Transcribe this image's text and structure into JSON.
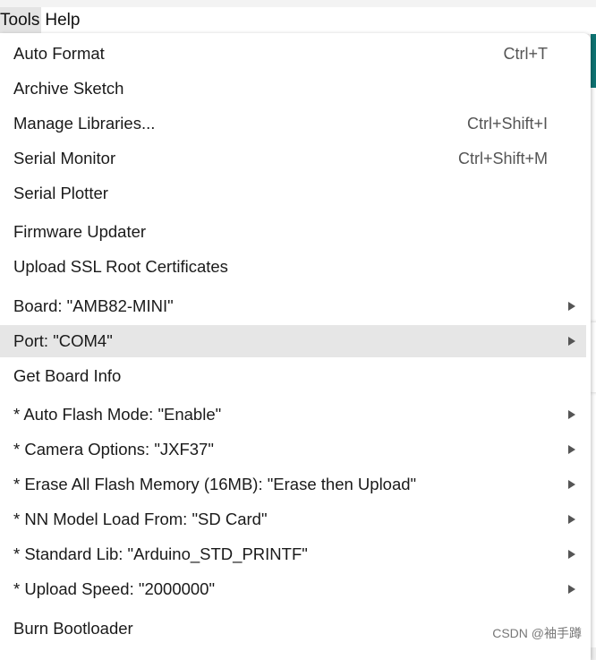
{
  "menubar": {
    "items": [
      {
        "label": "Tools",
        "active": true
      },
      {
        "label": "Help",
        "active": false
      }
    ]
  },
  "menu": {
    "items": [
      {
        "label": "Auto Format",
        "shortcut": "Ctrl+T"
      },
      {
        "label": "Archive Sketch"
      },
      {
        "label": "Manage Libraries...",
        "shortcut": "Ctrl+Shift+I"
      },
      {
        "label": "Serial Monitor",
        "shortcut": "Ctrl+Shift+M"
      },
      {
        "label": "Serial Plotter"
      },
      {
        "label": "Firmware Updater"
      },
      {
        "label": "Upload SSL Root Certificates"
      },
      {
        "label": "Board: \"AMB82-MINI\"",
        "submenu": true
      },
      {
        "label": "Port: \"COM4\"",
        "submenu": true,
        "highlighted": true
      },
      {
        "label": "Get Board Info"
      },
      {
        "label": "* Auto Flash Mode: \"Enable\"",
        "submenu": true
      },
      {
        "label": "* Camera Options: \"JXF37\"",
        "submenu": true
      },
      {
        "label": "* Erase All Flash Memory (16MB): \"Erase then Upload\"",
        "submenu": true
      },
      {
        "label": "* NN Model Load From: \"SD Card\"",
        "submenu": true
      },
      {
        "label": "* Standard Lib: \"Arduino_STD_PRINTF\"",
        "submenu": true
      },
      {
        "label": "* Upload Speed: \"2000000\"",
        "submenu": true
      },
      {
        "label": "Burn Bootloader"
      }
    ]
  },
  "watermark": "CSDN @袖手蹲",
  "colors": {
    "highlight": "#e6e6e6",
    "accent": "#0e7372"
  }
}
